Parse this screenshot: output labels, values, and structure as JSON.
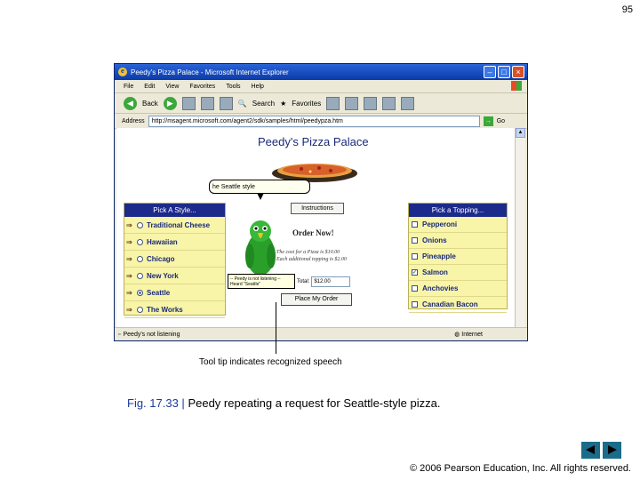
{
  "slide": {
    "number": "95"
  },
  "window": {
    "title": "Peedy's Pizza Palace - Microsoft Internet Explorer",
    "menu": [
      "File",
      "Edit",
      "View",
      "Favorites",
      "Tools",
      "Help"
    ],
    "toolbar": {
      "back": "Back",
      "search": "Search",
      "favorites": "Favorites"
    },
    "address": {
      "label": "Address",
      "url": "http://msagent.microsoft.com/agent2/sdk/samples/html/peedypza.htm",
      "go": "Go"
    },
    "status": {
      "text": "Peedy's not listening",
      "zone": "Internet"
    }
  },
  "page": {
    "title": "Peedy's Pizza Palace",
    "balloon": "he Seattle style",
    "instructions_button": "Instructions",
    "style_panel": {
      "header": "Pick A Style...",
      "items": [
        "Traditional Cheese",
        "Hawaiian",
        "Chicago",
        "New York",
        "Seattle",
        "The Works"
      ],
      "selected": "Seattle"
    },
    "topping_panel": {
      "header": "Pick a Topping...",
      "items": [
        "Pepperoni",
        "Onions",
        "Pineapple",
        "Salmon",
        "Anchovies",
        "Canadian Bacon"
      ],
      "checked": "Salmon"
    },
    "order": {
      "heading": "Order Now!",
      "line1": "The cost for a Pizza is $10.00",
      "line2": "Each additional topping is $2.00",
      "total_label": "Total:",
      "total_value": "$12.00",
      "tooltip": "-- Peedy is not listening -- Heard \"Seattle\"",
      "place_button": "Place My Order"
    }
  },
  "callout": "Tool tip indicates recognized speech",
  "caption": {
    "number": "Fig. 17.33 |",
    "text": "Peedy repeating a request for Seattle-style pizza."
  },
  "copyright": "© 2006 Pearson Education, Inc.  All rights reserved.",
  "colors": {
    "titlebar": "#0a3aa8",
    "panel_header": "#1c2a8c",
    "panel_bg": "#f8f4a8",
    "caption_blue": "#1a3a9c",
    "nav_btn": "#1a6c8a"
  }
}
